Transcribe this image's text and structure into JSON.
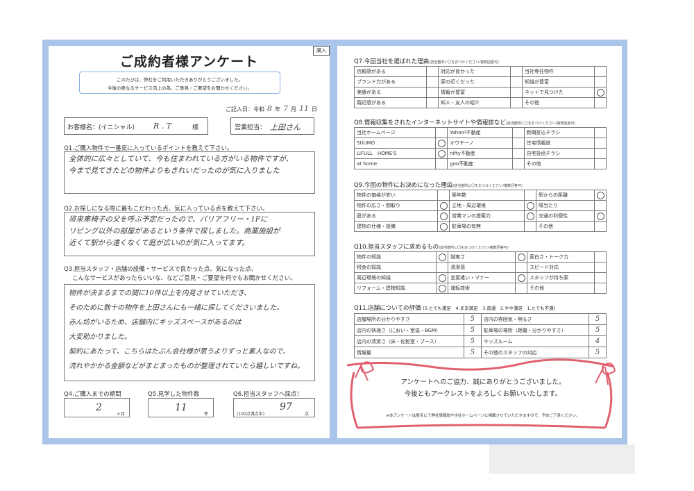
{
  "left": {
    "title": "ご成約者様アンケート",
    "tab": "購入",
    "intro": [
      "このたびは、弊社をご利用いただきありがとうございました。",
      "今後の更なるサービス向上の為、ご意見・ご要望をお聞かせください。"
    ],
    "date": {
      "label": "ご記入日：令和",
      "year": "8",
      "y": "年",
      "month": "7",
      "m": "月",
      "day": "11",
      "d": "日"
    },
    "customer": {
      "label": "お客様名：(イニシャル)",
      "value": "R . T",
      "suffix": "様"
    },
    "staff": {
      "label": "営業担当：",
      "value": "上田さん"
    },
    "q1": {
      "question": "Q1.ご購入物件で一番気に入っているポイントを教えて下さい。",
      "answer": [
        "全体的に広々としていて、今も住まわれている方がいる物件ですが、",
        "今まで見てきたどの物件よりもきれいだったのが気に入りました"
      ]
    },
    "q2": {
      "question": "Q2.お探しになる際に最もこだわった点、気に入っている点を教えて下さい。",
      "answer": [
        "将来車椅子の父を呼ぶ予定だったので、バリアフリー・1Fに",
        "リビング以外の部屋があるという条件で探しました。商業施設が",
        "近くて駅から遠くなくて庭が広いのが気に入ってます。"
      ]
    },
    "q3": {
      "question": [
        "Q3.担当スタッフ・店舗の設備・サービスで良かった点、気になった点、",
        "こんなサービスがあったらいいな、などご意見・ご要望を何でもお聞かせください。"
      ],
      "answer": [
        "物件が決まるまでの間に10件以上を内見させていただき、",
        "そのために数十の物件を上田さんにも一緒に探してくださいました。",
        "赤ん坊がいるため、店舗内にキッズスペースがあるのは",
        "大変助かりました。",
        "契約にあたって、こちらはたぶん会社様が思うよりずっと素人なので、",
        "流れやかかる金額などがまとまったものが整理されていたら嬉しいですね。"
      ]
    },
    "q4": {
      "question": "Q4.ご購入までの期間",
      "value": "2",
      "unit": "ヶ月"
    },
    "q5": {
      "question": "Q5.見学した物件数",
      "value": "11",
      "unit": "件"
    },
    "q6": {
      "question": "Q6.担当スタッフへ採点！",
      "prefix": "(100点満点中)",
      "value": "97",
      "unit": "点"
    }
  },
  "right": {
    "q7": {
      "title": "Q7.今回当社を選ばれた理由",
      "note": "(該当箇所に〇をおつけください/複数回答可)",
      "rows": [
        [
          {
            "t": "信頼感がある",
            "m": ""
          },
          {
            "t": "対応が良かった",
            "m": ""
          },
          {
            "t": "当社専任物件",
            "m": ""
          }
        ],
        [
          {
            "t": "ブランド力がある",
            "m": ""
          },
          {
            "t": "家の近くだった",
            "m": ""
          },
          {
            "t": "知識が豊富",
            "m": ""
          }
        ],
        [
          {
            "t": "実績がある",
            "m": ""
          },
          {
            "t": "情報が豊富",
            "m": ""
          },
          {
            "t": "ネットで見つけた",
            "m": "o"
          }
        ],
        [
          {
            "t": "親近感がある",
            "m": ""
          },
          {
            "t": "知人・友人の紹介",
            "m": ""
          },
          {
            "t": "その他",
            "m": ""
          }
        ]
      ]
    },
    "q8": {
      "title": "Q8.情報収集をされたインターネットサイトや情報誌など",
      "note": "(該当箇所に〇をおつけください/複数回答可)",
      "rows": [
        [
          {
            "t": "当社ホームページ",
            "m": ""
          },
          {
            "t": "Yahoo!不動産",
            "m": ""
          },
          {
            "t": "新聞折込チラシ",
            "m": ""
          }
        ],
        [
          {
            "t": "SUUMO",
            "m": "o"
          },
          {
            "t": "オウチーノ",
            "m": ""
          },
          {
            "t": "住宅情報誌",
            "m": ""
          }
        ],
        [
          {
            "t": "LIFULL　HOME'S",
            "m": "o"
          },
          {
            "t": "nifty不動産",
            "m": ""
          },
          {
            "t": "自宅投函チラシ",
            "m": ""
          }
        ],
        [
          {
            "t": "at home",
            "m": ""
          },
          {
            "t": "goo不動産",
            "m": ""
          },
          {
            "t": "その他",
            "m": ""
          }
        ]
      ]
    },
    "q9": {
      "title": "Q9.今回の物件にお決めになった理由",
      "note": "(該当箇所に〇をおつけください/複数回答可)",
      "rows": [
        [
          {
            "t": "物件の価格が安い",
            "m": ""
          },
          {
            "t": "築年数",
            "m": ""
          },
          {
            "t": "駅からの距離",
            "m": "o"
          }
        ],
        [
          {
            "t": "物件の広さ・間取り",
            "m": "o"
          },
          {
            "t": "立地・周辺環境",
            "m": "o"
          },
          {
            "t": "陽当たり",
            "m": ""
          }
        ],
        [
          {
            "t": "庭がある",
            "m": "o"
          },
          {
            "t": "営業マンの提案力",
            "m": "o"
          },
          {
            "t": "交通の利便性",
            "m": "o"
          }
        ],
        [
          {
            "t": "建物の仕様・設備",
            "m": "o"
          },
          {
            "t": "駐車場の有無",
            "m": ""
          },
          {
            "t": "その他",
            "m": ""
          }
        ]
      ]
    },
    "q10": {
      "title": "Q10.担当スタッフに求めるもの",
      "note": "(該当箇所に〇をおつけください/複数回答可)",
      "rows": [
        [
          {
            "t": "物件の知識",
            "m": "o"
          },
          {
            "t": "誠実さ",
            "m": "o"
          },
          {
            "t": "面白さ・トーク力",
            "m": ""
          }
        ],
        [
          {
            "t": "税金の知識",
            "m": ""
          },
          {
            "t": "清潔感",
            "m": ""
          },
          {
            "t": "スピード対応",
            "m": ""
          }
        ],
        [
          {
            "t": "周辺環境の知識",
            "m": "o"
          },
          {
            "t": "言葉遣い・マナー",
            "m": "o"
          },
          {
            "t": "スタッフが持ち家",
            "m": ""
          }
        ],
        [
          {
            "t": "リフォーム・建物知識",
            "m": "o"
          },
          {
            "t": "運転技術",
            "m": ""
          },
          {
            "t": "その他",
            "m": ""
          }
        ]
      ]
    },
    "q11": {
      "title": "Q11.店舗についての評価",
      "scale": "(5.とても満足　4.まあ満足　3.普通　2.やや満足　1.とても不満)",
      "rows": [
        [
          {
            "t": "店舗場所の分かりやすさ",
            "s": "5"
          },
          {
            "t": "店内の雰囲気・明るさ",
            "s": "5"
          }
        ],
        [
          {
            "t": "店内の快適さ（におい・室温・BGM）",
            "s": "5"
          },
          {
            "t": "駐車場の場所（距離・分かりやすさ）",
            "s": "5"
          }
        ],
        [
          {
            "t": "店内の清潔さ（床・化粧室・ブース）",
            "s": "5"
          },
          {
            "t": "キッズルーム",
            "s": "4"
          }
        ],
        [
          {
            "t": "情報量",
            "s": "5"
          },
          {
            "t": "その他のスタッフの対応",
            "s": "5"
          }
        ]
      ]
    },
    "thanks": [
      "アンケートへのご協力、誠にありがとうございました。",
      "今後ともアークレストをよろしくお願いいたします。"
    ],
    "disclaimer": "※本アンケートは匿名にて弊社情報誌や当社ホームページに掲載させていただきますので、予めご了承ください。"
  },
  "colors": {
    "frame": "#a9c5ea",
    "ribbon": "#e06070"
  }
}
